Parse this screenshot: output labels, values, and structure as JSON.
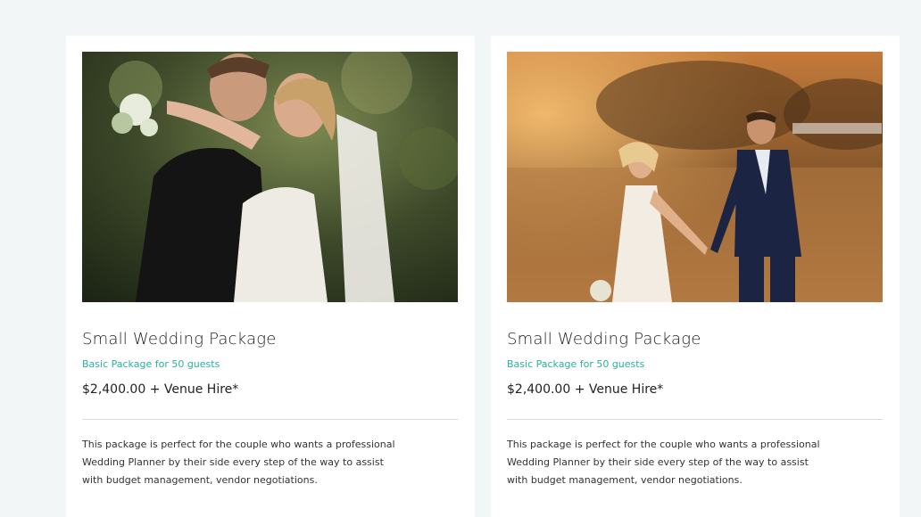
{
  "packages": [
    {
      "title": "Small Wedding Package",
      "subtitle": "Basic Package for 50 guests",
      "price": "$2,400.00 + Venue Hire*",
      "description": "This package is perfect for the couple who wants a professional Wedding Planner by their side every step of the way to assist with budget management, vendor negotiations.",
      "image": "photo-couple-embrace"
    },
    {
      "title": "Small Wedding Package",
      "subtitle": "Basic Package for 50 guests",
      "price": "$2,400.00 + Venue Hire*",
      "description": "This package is perfect for the couple who wants a professional Wedding Planner by their side every step of the way to assist with budget management, vendor negotiations.",
      "image": "photo-couple-walking-sunset"
    }
  ],
  "colors": {
    "page_bg": "#f3f6f6",
    "card_bg": "#ffffff",
    "accent": "#2ab0a0"
  }
}
